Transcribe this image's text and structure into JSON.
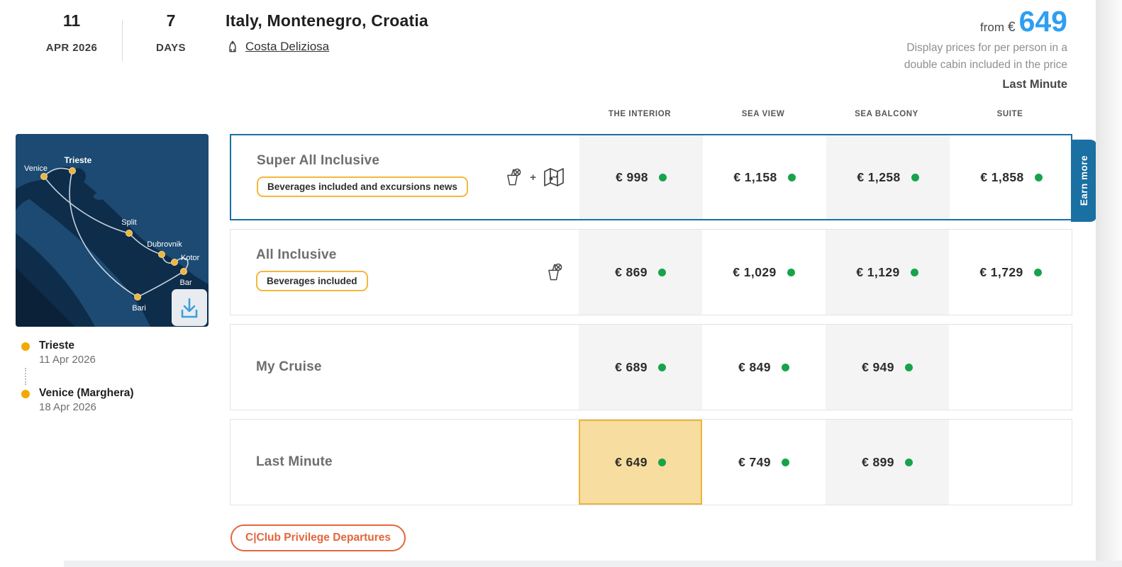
{
  "header": {
    "date_day": "11",
    "date_month": "APR 2026",
    "duration_value": "7",
    "duration_label": "DAYS",
    "title": "Italy, Montenegro, Croatia",
    "ship_name": "Costa Deliziosa",
    "price_from_label": "from",
    "price_currency": "€",
    "price_value": "649",
    "price_note_line1": "Display prices for per person in a",
    "price_note_line2": "double cabin included in the price",
    "price_category": "Last Minute"
  },
  "columns": [
    "THE INTERIOR",
    "SEA VIEW",
    "SEA BALCONY",
    "SUITE"
  ],
  "rows": [
    {
      "name": "Super All Inclusive",
      "badge": "Beverages included and excursions news",
      "icons": [
        "drink-icon",
        "plus",
        "map-icon"
      ],
      "plus": "+",
      "selected": true,
      "side_tab": "Earn more",
      "prices": [
        "€ 998",
        "€ 1,158",
        "€ 1,258",
        "€ 1,858"
      ]
    },
    {
      "name": "All Inclusive",
      "badge": "Beverages included",
      "icons": [
        "drink-icon"
      ],
      "prices": [
        "€ 869",
        "€ 1,029",
        "€ 1,129",
        "€ 1,729"
      ]
    },
    {
      "name": "My Cruise",
      "prices": [
        "€ 689",
        "€ 849",
        "€ 949",
        null
      ]
    },
    {
      "name": "Last Minute",
      "prices": [
        "€ 649",
        "€ 749",
        "€ 899",
        null
      ],
      "highlighted_price_index": 0
    }
  ],
  "map": {
    "ports": [
      "Venice",
      "Trieste",
      "Split",
      "Dubrovnik",
      "Kotor",
      "Bar",
      "Bari"
    ],
    "download_icon": "download-icon"
  },
  "itinerary": [
    {
      "name": "Trieste",
      "date": "11 Apr 2026"
    },
    {
      "name": "Venice (Marghera)",
      "date": "18 Apr 2026"
    }
  ],
  "footer": {
    "cclub_label": "C|Club Privilege Departures"
  },
  "colors": {
    "accent_blue": "#2e9ff2",
    "selected_border_blue": "#1a6fa3",
    "availability_green": "#17a34a",
    "badge_amber": "#f5b73a",
    "highlight_cell_bg": "#f7dd9f",
    "highlight_cell_border": "#edb43e",
    "cclub_orange": "#e4663c",
    "port_dot_yellow": "#edb541",
    "map_sea": "#0e2d4b",
    "map_land": "#1c4a72"
  }
}
